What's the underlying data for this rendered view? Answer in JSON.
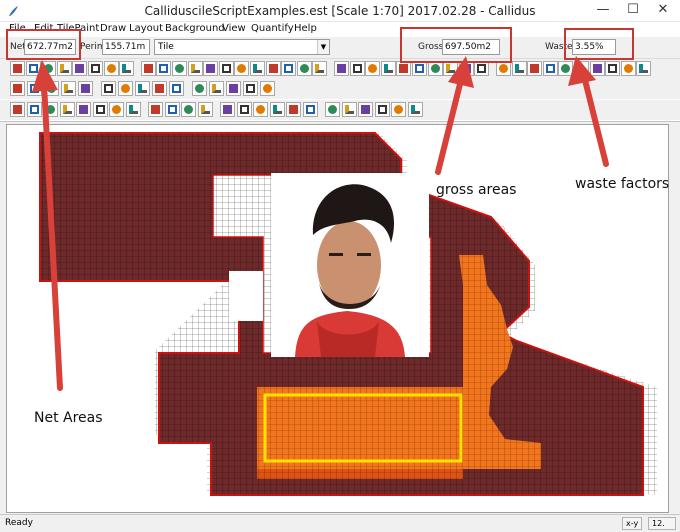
{
  "window": {
    "title": "CalliduscileScriptExamples.est   [Scale 1:70]  2017.02.28 - Callidus",
    "minimize_glyph": "—",
    "maximize_glyph": "☐",
    "close_glyph": "✕"
  },
  "menu": [
    "File",
    "Edit",
    "TilePaint",
    "Draw",
    "Layout",
    "Background",
    "View",
    "Quantify",
    "Help"
  ],
  "fields": {
    "net_label": "Net",
    "net_value": "672.77m2",
    "perim_label": "Perim.",
    "perim_value": "155.71m",
    "material_value": "Tile",
    "gross_label": "Gross",
    "gross_value": "697.50m2",
    "waste_label": "Waste",
    "waste_value": "3.55%"
  },
  "toolbar_icons": {
    "row1": [
      "eraser-icon",
      "paint-tile-icon",
      "rectangle-icon",
      "circle-icon",
      "fill-icon",
      "text-icon",
      "pen-icon",
      "layer-icon",
      "number-icon",
      "select-icon",
      "move-icon",
      "copy-icon",
      "paste-icon",
      "rotate-icon",
      "mirror-icon",
      "arc-icon",
      "group-icon",
      "ungroup-icon",
      "colour-icon",
      "stack-icon",
      "snap-icon",
      "magic-icon",
      "wand-icon",
      "lock-icon",
      "grid-icon",
      "layer-up-icon",
      "layer-down-icon",
      "align-icon",
      "front-icon",
      "back-icon",
      "split-icon",
      "merge-icon",
      "tile-icon",
      "cut-tile-icon",
      "half-tile-icon",
      "measure-icon",
      "frame-icon",
      "waste-icon",
      "red-tile-icon",
      "adjust-icon"
    ],
    "row2": [
      "line-icon",
      "polyline-icon",
      "square-icon",
      "polygon-icon",
      "trim-icon",
      "node-icon",
      "rect-tool-icon",
      "diagonal-icon",
      "image-icon",
      "house-icon",
      "flag-icon",
      "pattern-icon",
      "brush-icon",
      "loop-icon",
      "warp-icon"
    ],
    "row3": [
      "new-icon",
      "open-icon",
      "save-icon",
      "save-as-icon",
      "preview-icon",
      "print-icon",
      "pdf-icon",
      "zoom-in-icon",
      "undo-icon",
      "redo-icon",
      "palette-icon",
      "tiles-icon",
      "library-icon",
      "layers-icon",
      "export-icon",
      "report-icon",
      "calc-icon",
      "find-icon",
      "play-icon",
      "step-icon",
      "forward-icon",
      "sigma-icon",
      "record-icon",
      "script-icon"
    ]
  },
  "annotations": {
    "net_areas": "Net Areas",
    "gross_areas": "gross areas",
    "waste_factors": "waste factors"
  },
  "status": {
    "text": "Ready",
    "axis": "x-y",
    "zoom": "12."
  },
  "colors": {
    "tile_dark": "#6e2a2a",
    "tile_orange_light": "#f2761d",
    "tile_orange_dark": "#dd5314",
    "highlight_yellow": "#ffe200",
    "outline_red": "#cc1111",
    "callout_red": "#d8413a"
  }
}
